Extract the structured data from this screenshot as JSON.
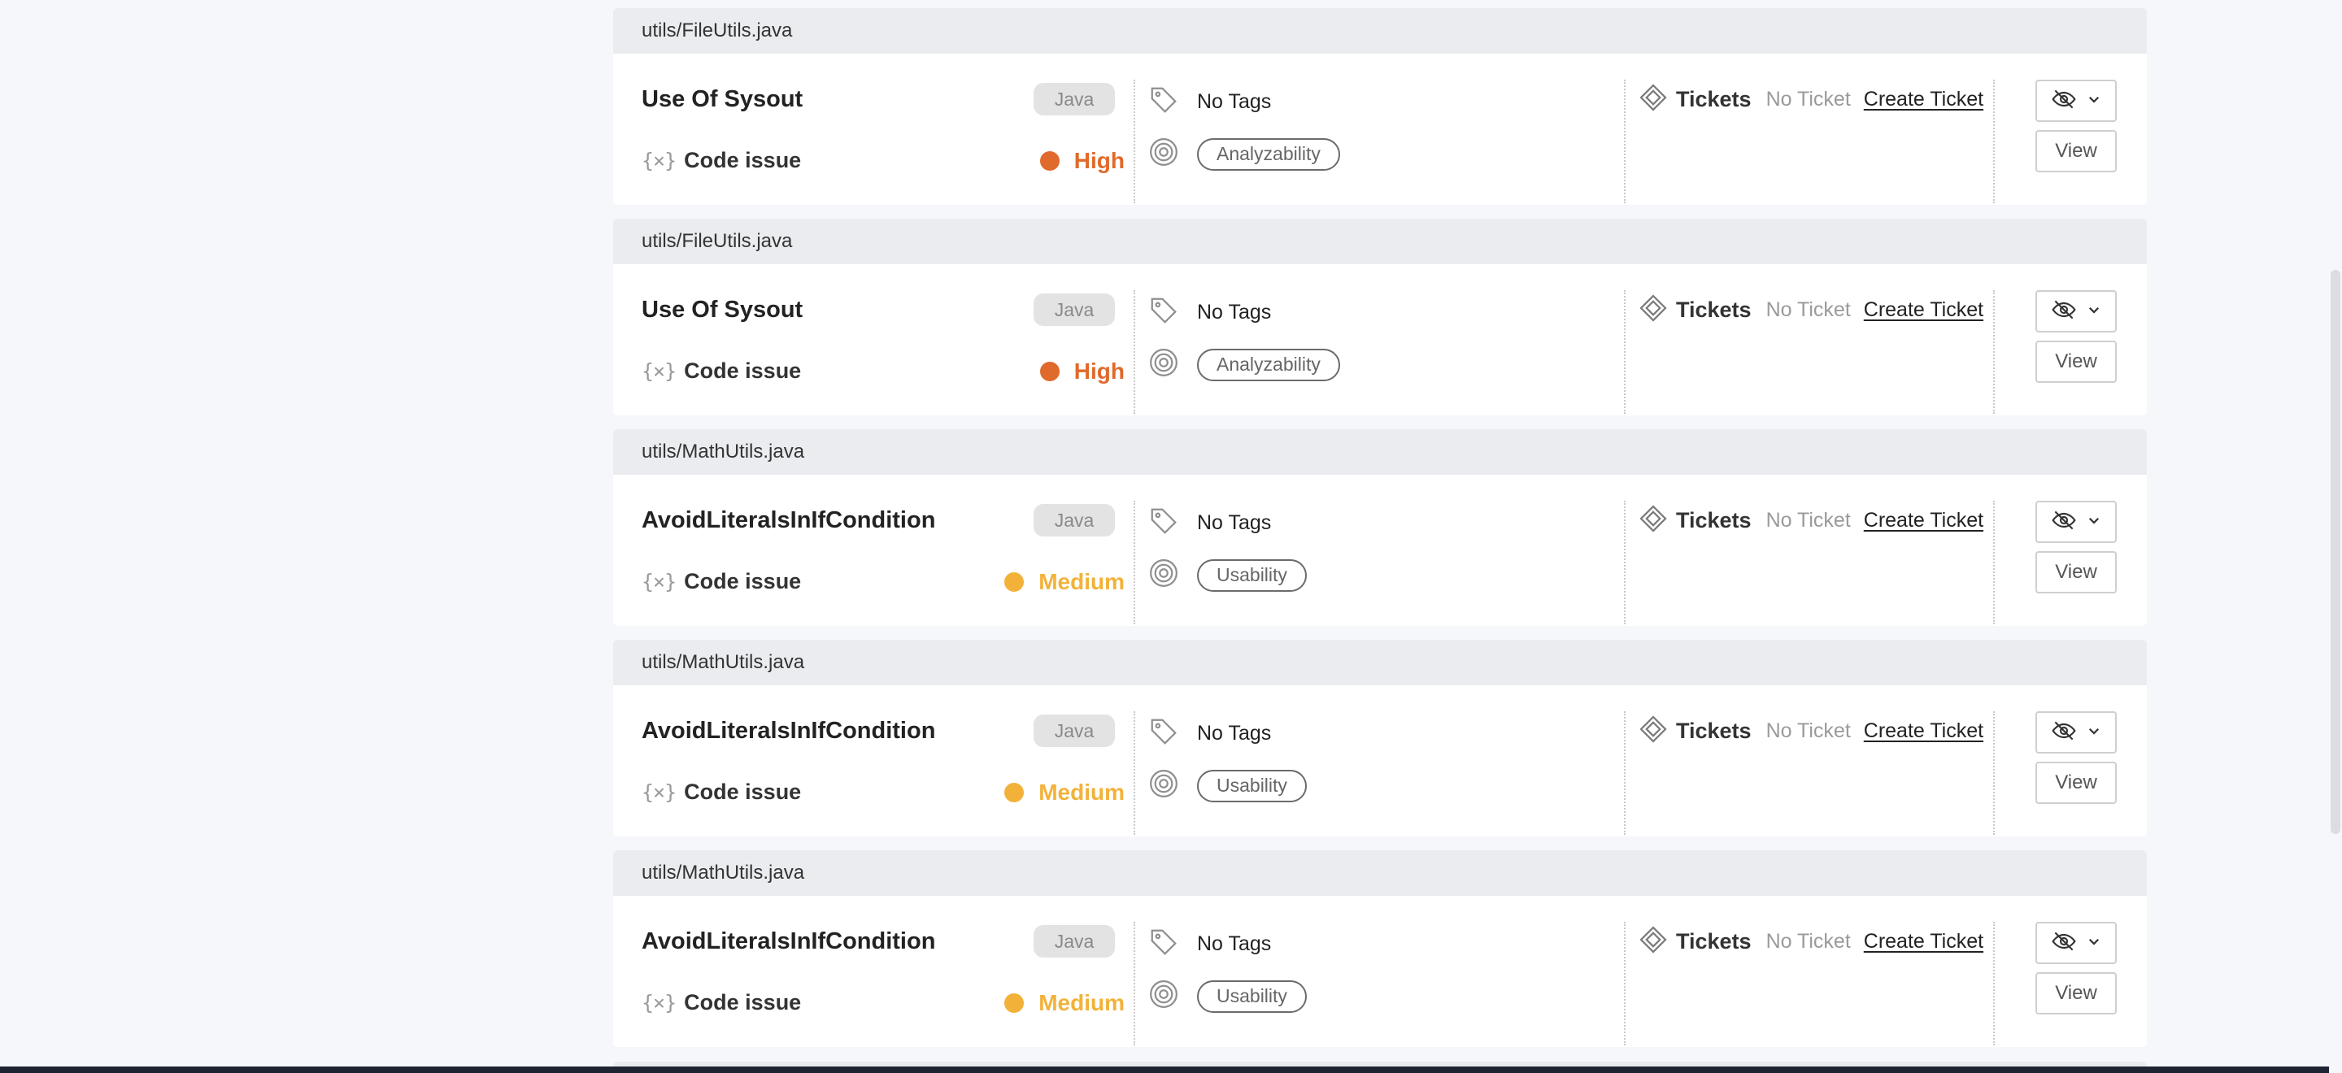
{
  "labels": {
    "code_issue": "Code issue",
    "tickets": "Tickets",
    "no_ticket": "No Ticket",
    "create_ticket": "Create Ticket",
    "view": "View",
    "no_tags": "No Tags"
  },
  "severity_colors": {
    "High": "#e06a2b",
    "Medium": "#f2b23a"
  },
  "icons": {
    "type": "code-variable-icon",
    "tag": "tag-icon",
    "category": "target-icon",
    "tickets": "ticket-icon",
    "hide": "eye-slash-icon",
    "dropdown": "chevron-down-icon"
  },
  "issues": [
    {
      "file": "utils/FileUtils.java",
      "title": "Use Of Sysout",
      "language": "Java",
      "severity": "High",
      "tags": "No Tags",
      "category": "Analyzability"
    },
    {
      "file": "utils/FileUtils.java",
      "title": "Use Of Sysout",
      "language": "Java",
      "severity": "High",
      "tags": "No Tags",
      "category": "Analyzability"
    },
    {
      "file": "utils/MathUtils.java",
      "title": "AvoidLiteralsInIfCondition",
      "language": "Java",
      "severity": "Medium",
      "tags": "No Tags",
      "category": "Usability"
    },
    {
      "file": "utils/MathUtils.java",
      "title": "AvoidLiteralsInIfCondition",
      "language": "Java",
      "severity": "Medium",
      "tags": "No Tags",
      "category": "Usability"
    },
    {
      "file": "utils/MathUtils.java",
      "title": "AvoidLiteralsInIfCondition",
      "language": "Java",
      "severity": "Medium",
      "tags": "No Tags",
      "category": "Usability"
    }
  ]
}
